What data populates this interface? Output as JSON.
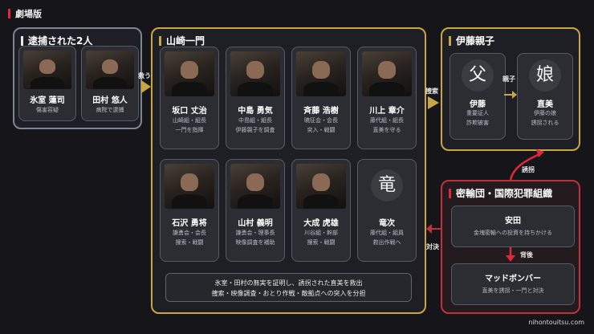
{
  "header": "劇場版",
  "colors": {
    "accent_red": "#e0283a",
    "gold": "#c9a640",
    "gray": "#7d8594",
    "dark_red": "#c0303d"
  },
  "groups": {
    "arrest": {
      "title": "逮捕された2人",
      "members": [
        {
          "name": "氷室 蓮司",
          "desc1": "傷害容疑"
        },
        {
          "name": "田村 悠人",
          "desc1": "病院で逮捕"
        }
      ]
    },
    "yamazaki": {
      "title": "山崎一門",
      "members": [
        {
          "name": "坂口 丈治",
          "desc1": "山崎組・組長",
          "desc2": "一門を指揮"
        },
        {
          "name": "中島 勇気",
          "desc1": "中島組・組長",
          "desc2": "伊藤親子を調査"
        },
        {
          "name": "斉藤 浩樹",
          "desc1": "暁征会・会長",
          "desc2": "突入・戦闘"
        },
        {
          "name": "川上 章介",
          "desc1": "藤代組・組長",
          "desc2": "直美を守る"
        },
        {
          "name": "石沢 勇将",
          "desc1": "謙勇会・会長",
          "desc2": "捜索・戦闘"
        },
        {
          "name": "山村 義明",
          "desc1": "謙勇会・理事長",
          "desc2": "映像調査を補助"
        },
        {
          "name": "大成 虎雄",
          "desc1": "川谷組・幹部",
          "desc2": "捜索・戦闘"
        },
        {
          "name": "竜次",
          "symbol": "竜",
          "desc1": "藤代組・組員",
          "desc2": "救出作戦へ"
        }
      ],
      "summary_line1": "氷室・田村の無実を証明し、誘拐された直美を救出",
      "summary_line2": "捜索・映像調査・おとり作戦・敵拠点への突入を分担"
    },
    "ito": {
      "title": "伊藤親子",
      "members": [
        {
          "name": "伊藤",
          "symbol": "父",
          "desc1": "重要証人",
          "desc2": "詐欺被害"
        },
        {
          "name": "直美",
          "symbol": "娘",
          "desc1": "伊藤の娘",
          "desc2": "誘拐される"
        }
      ],
      "link_label": "親子"
    },
    "smuggling": {
      "title": "密輸団・国際犯罪組織",
      "members": [
        {
          "name": "安田",
          "desc1": "金塊密輸への投資を持ちかける"
        },
        {
          "name": "マッドボンバー",
          "desc1": "直美を誘拐・一門と対決"
        }
      ],
      "link_label": "背後"
    }
  },
  "edges": {
    "rescue": "救う",
    "search": "捜索",
    "kidnap": "誘拐",
    "confront": "対決"
  },
  "footer": "nihontouitsu.com"
}
